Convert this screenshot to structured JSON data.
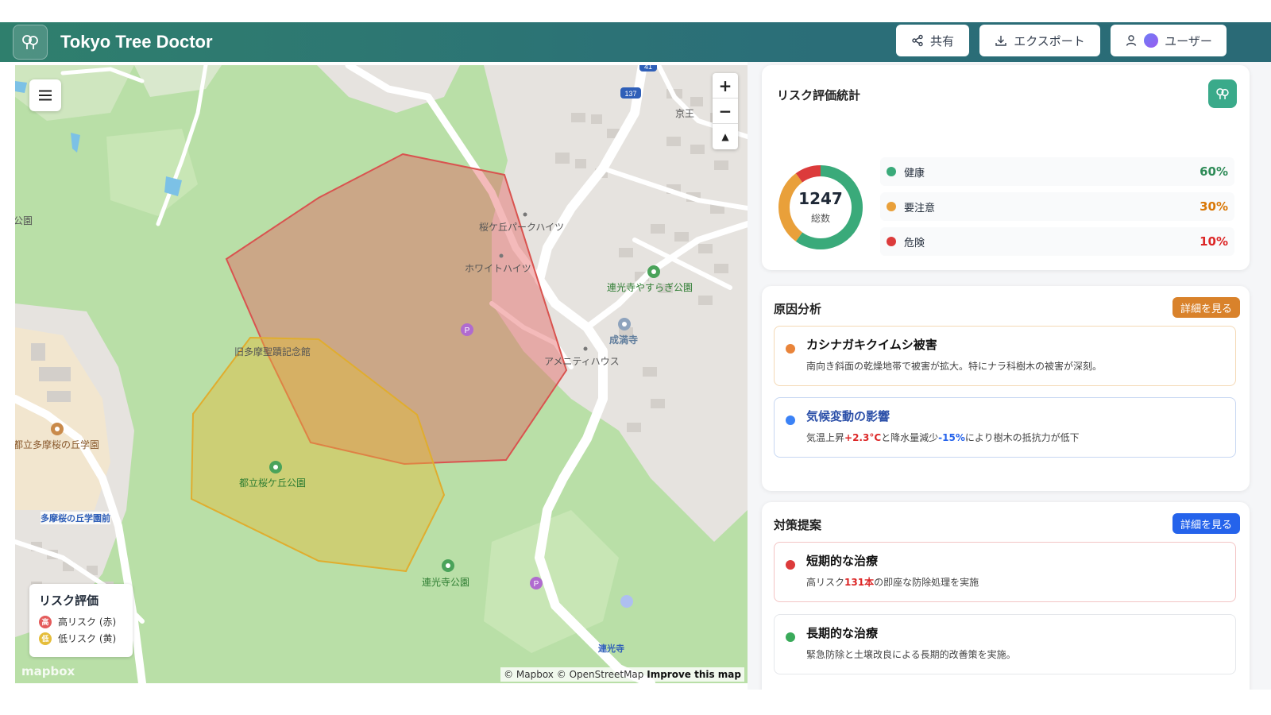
{
  "app": {
    "title": "Tokyo Tree Doctor"
  },
  "header": {
    "share_label": "共有",
    "export_label": "エクスポート",
    "user_label": "ユーザー"
  },
  "map": {
    "labels": {
      "sakuragaoka_heights": "桜ケ丘パークハイツ",
      "white_heights": "ホワイトハイツ",
      "renkoji_yasuragi": "連光寺やすらぎ公園",
      "jomanji": "成満寺",
      "amenity_house": "アメニティハウス",
      "kyuutama": "旧多摩聖蹟記念館",
      "toritsu_tama_school": "都立多摩桜の丘学園",
      "toritsu_sakuragaoka_park": "都立桜ケ丘公園",
      "tama_sakura_stop": "多摩桜の丘学園前",
      "renkoji_park": "連光寺公園",
      "renkoji": "連光寺",
      "keio": "京王",
      "park_left": "公園",
      "route137": "137",
      "route41": "41"
    },
    "legend": {
      "title": "リスク評価",
      "high_badge": "高",
      "high_label": "高リスク (赤)",
      "low_badge": "低",
      "low_label": "低リスク (黄)"
    },
    "attribution": {
      "mapbox": "© Mapbox",
      "osm": "© OpenStreetMap",
      "improve": "Improve this map"
    },
    "mapbox_logo": "mapbox",
    "colors": {
      "high_risk": "#e45b5b",
      "low_risk": "#e5bd3a"
    }
  },
  "stats": {
    "title": "リスク評価統計",
    "total": "1247",
    "total_label": "総数",
    "items": [
      {
        "label": "健康",
        "pct": "60%",
        "value": 60,
        "color": "#3aaa7a"
      },
      {
        "label": "要注意",
        "pct": "30%",
        "value": 30,
        "color": "#e9a03a"
      },
      {
        "label": "危険",
        "pct": "10%",
        "value": 10,
        "color": "#dc3b3b"
      }
    ]
  },
  "causes": {
    "title": "原因分析",
    "detail_label": "詳細を見る",
    "items": [
      {
        "title": "カシナガキクイムシ被害",
        "desc": "南向き斜面の乾燥地帯で被害が拡大。特にナラ科樹木の被害が深刻。",
        "color": "#e9843a",
        "border": "#f4d9b5"
      },
      {
        "title": "気候変動の影響",
        "desc_a": "気温上昇",
        "temp": "+2.3°C",
        "desc_b": "と降水量減少",
        "rain": "-15%",
        "desc_c": "により樹木の抵抗力が低下",
        "color": "#3b82f6",
        "border": "#c7d7f2"
      }
    ]
  },
  "measures": {
    "title": "対策提案",
    "detail_label": "詳細を見る",
    "items": [
      {
        "title": "短期的な治療",
        "desc_a": "高リスク",
        "count": "131本",
        "desc_b": "の即座な防除処理を実施",
        "color": "#dc3b3b",
        "border": "#f3c4c4"
      },
      {
        "title": "長期的な治療",
        "desc": "緊急防除と土壌改良による長期的改善策を実施。",
        "color": "#3aaa5a",
        "border": "#e5e7eb"
      }
    ]
  }
}
